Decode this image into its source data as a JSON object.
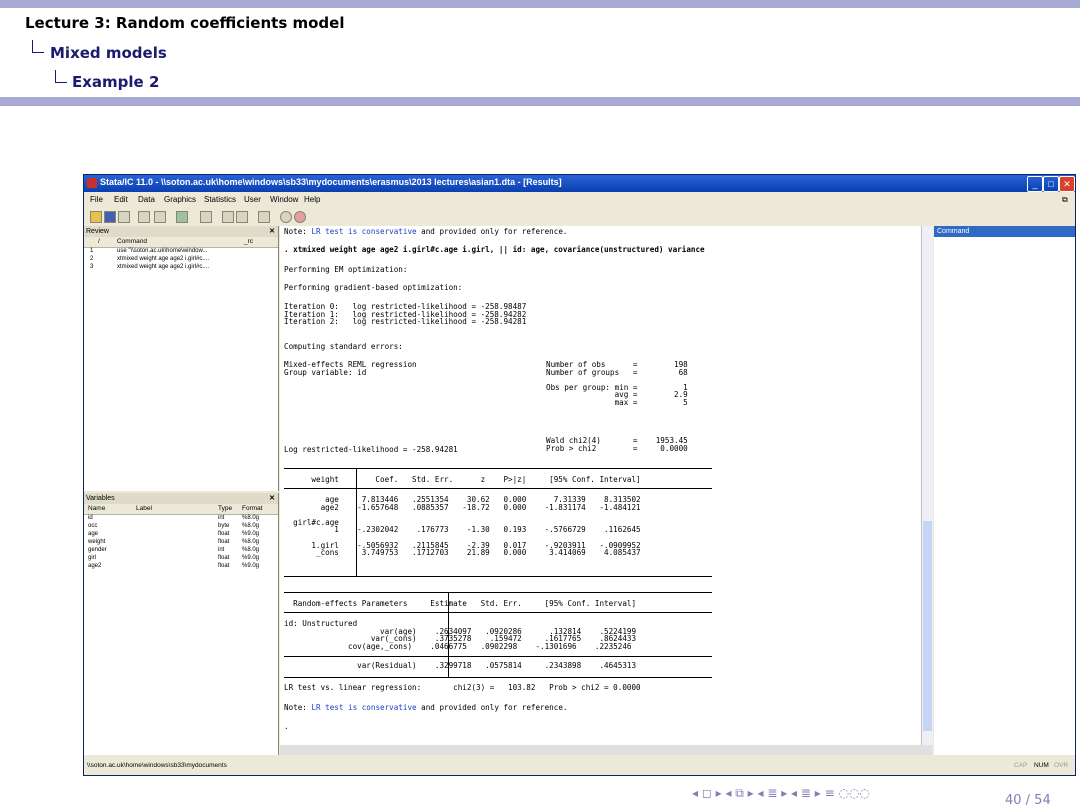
{
  "slide": {
    "title": "Lecture 3: Random coefficients model",
    "section": "Mixed models",
    "subsection": "Example 2",
    "page": "40 / 54",
    "nav_symbols": "◂ ◻ ▸ ◂ ⧉ ▸ ◂ ≣ ▸ ◂ ≣ ▸   ≡   ◌◌◌"
  },
  "window": {
    "title": "Stata/IC 11.0 - \\\\soton.ac.uk\\home\\windows\\sb33\\mydocuments\\erasmus\\2013 lectures\\asian1.dta - [Results]",
    "menu": [
      "File",
      "Edit",
      "Data",
      "Graphics",
      "Statistics",
      "User",
      "Window",
      "Help"
    ],
    "status_path": "\\\\soton.ac.uk\\home\\windows\\sb33\\mydocuments",
    "status_flags": [
      "CAP",
      "NUM",
      "OVR"
    ]
  },
  "review": {
    "title": "Review",
    "columns": [
      "/",
      "Command",
      "_rc"
    ],
    "rows": [
      {
        "n": "1",
        "cmd": "use \"\\\\soton.ac.uk\\home\\window..."
      },
      {
        "n": "2",
        "cmd": "xtmixed weight age age2 i.girl#c...."
      },
      {
        "n": "3",
        "cmd": "xtmixed weight age age2 i.girl#c...."
      }
    ]
  },
  "variables": {
    "title": "Variables",
    "columns": [
      "Name",
      "Label",
      "Type",
      "Format"
    ],
    "rows": [
      {
        "name": "id",
        "type": "int",
        "format": "%8.0g"
      },
      {
        "name": "occ",
        "type": "byte",
        "format": "%8.0g"
      },
      {
        "name": "age",
        "type": "float",
        "format": "%9.0g"
      },
      {
        "name": "weight",
        "type": "float",
        "format": "%8.0g"
      },
      {
        "name": "gender",
        "type": "int",
        "format": "%8.0g"
      },
      {
        "name": "girl",
        "type": "float",
        "format": "%9.0g"
      },
      {
        "name": "age2",
        "type": "float",
        "format": "%9.0g"
      }
    ]
  },
  "command_pane": {
    "title": "Command"
  },
  "results": {
    "note_top_a": "Note: ",
    "note_top_b": "LR test is conservative",
    "note_top_c": " and provided only for reference.",
    "command": ". xtmixed weight age age2 i.girl#c.age i.girl, || id: age, covariance(unstructured) variance",
    "em": "Performing EM optimization:",
    "grad": "Performing gradient-based optimization:",
    "iterations": "Iteration 0:   log restricted-likelihood = -258.98487\nIteration 1:   log restricted-likelihood = -258.94282\nIteration 2:   log restricted-likelihood = -258.94281",
    "computing": "Computing standard errors:",
    "header_left": "Mixed-effects REML regression\nGroup variable: id",
    "header_right": "Number of obs      =        198\nNumber of groups   =         68\n\nObs per group: min =          1\n               avg =        2.9\n               max =          5",
    "wald": "Wald chi2(4)       =    1953.45\nProb > chi2        =     0.0000",
    "loglik": "Log restricted-likelihood = -258.94281",
    "fe_header": "      weight        Coef.   Std. Err.      z    P>|z|     [95% Conf. Interval]",
    "fe_rows": "         age     7.813446   .2551354    30.62   0.000      7.31339    8.313502\n        age2    -1.657648   .0885357   -18.72   0.000    -1.831174   -1.484121\n\n  girl#c.age\n           1    -.2302042    .176773    -1.30   0.193    -.5766729    .1162645\n\n      1.girl    -.5056932   .2115845    -2.39   0.017    -.9203911   -.0909952\n       _cons     3.749753   .1712703    21.89   0.000     3.414069    4.085437",
    "re_header": "  Random-effects Parameters     Estimate   Std. Err.     [95% Conf. Interval]",
    "re_rows": "id: Unstructured\n                     var(age)    .2634097   .0920286      .132814    .5224199\n                   var(_cons)    .3735278    .159472     .1617765    .8624433\n              cov(age,_cons)    .0466775   .0902298    -.1301696    .2235246",
    "re_resid": "                var(Residual)    .3299718   .0575814     .2343898    .4645313",
    "lr_test": "LR test vs. linear regression:       chi2(3) =   103.82   Prob > chi2 = 0.0000",
    "note_bot_a": "Note: ",
    "note_bot_b": "LR test is conservative",
    "note_bot_c": " and provided only for reference.",
    "prompt": "."
  }
}
